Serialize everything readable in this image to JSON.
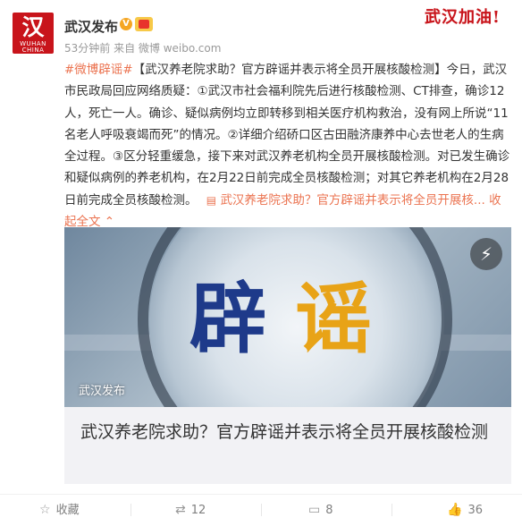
{
  "post": {
    "avatar": {
      "glyph": "汉",
      "sub": "WUHAN CHINA"
    },
    "author": "武汉发布",
    "verified_icon": "v-badge-icon",
    "badge_icon": "vip-ribbon-icon",
    "meta": "53分钟前 来自 微博 weibo.com",
    "stamp_text": "武汉加油!",
    "hashtag": "#微博辟谣#",
    "text": "【武汉养老院求助？官方辟谣并表示将全员开展核酸检测】今日，武汉市民政局回应网络质疑：①武汉市社会福利院先后进行核酸检测、CT排查，确诊12人，死亡一人。确诊、疑似病例均立即转移到相关医疗机构救治，没有网上所说“11名老人呼吸衰竭而死”的情况。②详细介绍硚口区古田融济康养中心去世老人的生病全过程。③区分轻重缓急，接下来对武汉养老机构全员开展核酸检测。对已发生确诊和疑似病例的养老机构，在2月22日前完成全员核酸检测；对其它养老机构在2月28日前完成全员核酸检测。",
    "link_icon": "article-icon",
    "link_text": "武汉养老院求助？官方辟谣并表示将全员开展核...",
    "collapse_text": "收起全文",
    "collapse_icon": "chevron-up-icon"
  },
  "article": {
    "hero_word_1": "辟",
    "hero_word_2": "谣",
    "bolt_icon": "lightning-icon",
    "caption": "武汉发布",
    "title": "武汉养老院求助？官方辟谣并表示将全员开展核酸检测"
  },
  "actions": {
    "favorite_label": "收藏",
    "repost_count": "12",
    "comment_count": "8",
    "like_count": "36"
  }
}
